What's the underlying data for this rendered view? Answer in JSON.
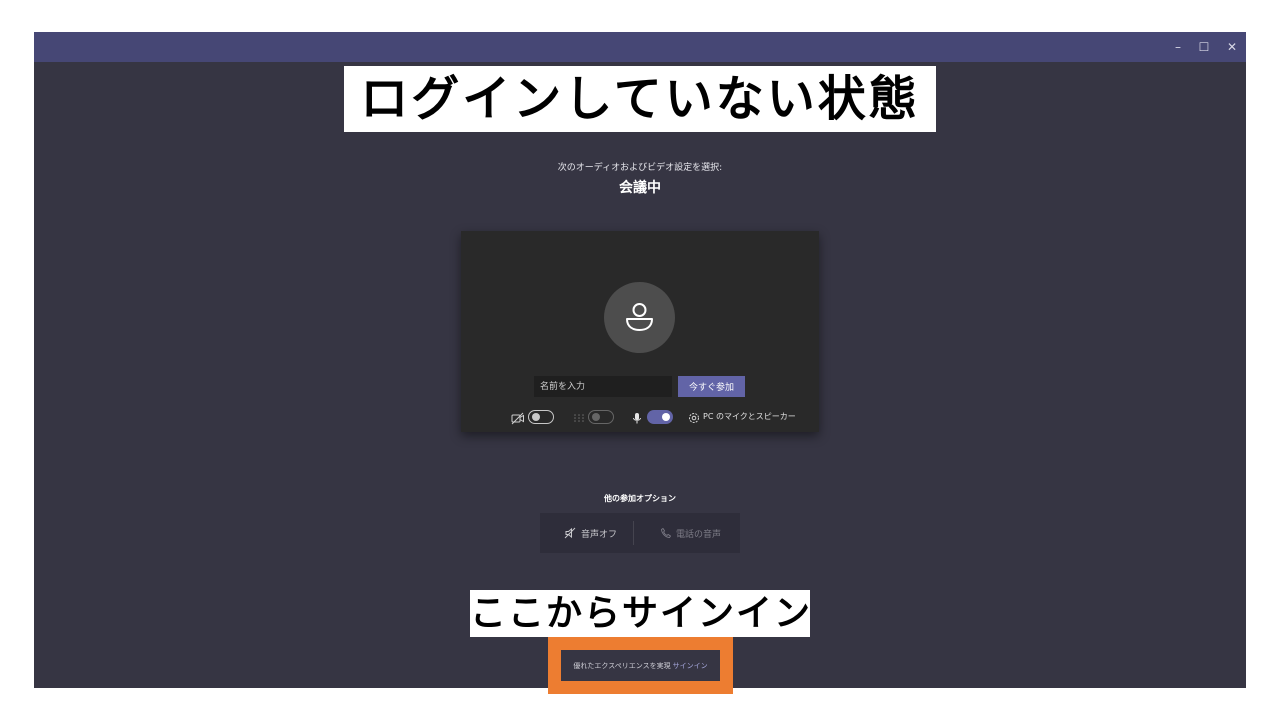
{
  "window": {
    "controls": {
      "minimize": "–",
      "maximize": "☐",
      "close": "✕"
    }
  },
  "annotations": {
    "state_title": "ログインしていない状態",
    "signin_hint": "ここからサインイン",
    "highlight_color": "#ed7d31"
  },
  "prejoin": {
    "prompt": "次のオーディオおよびビデオ設定を選択:",
    "meeting_title": "会議中",
    "name_placeholder": "名前を入力",
    "join_button": "今すぐ参加",
    "controls": {
      "camera_toggle": "off",
      "blur_toggle": "disabled",
      "mic_toggle": "on",
      "device_label": "PC のマイクとスピーカー"
    }
  },
  "other_options": {
    "title": "他の参加オプション",
    "audio_off": "音声オフ",
    "phone_audio": "電話の音声"
  },
  "signin_bar": {
    "text": "優れたエクスペリエンスを実現",
    "link": "サインイン"
  },
  "colors": {
    "titlebar": "#464775",
    "background": "#363543",
    "accent": "#6264a7"
  }
}
